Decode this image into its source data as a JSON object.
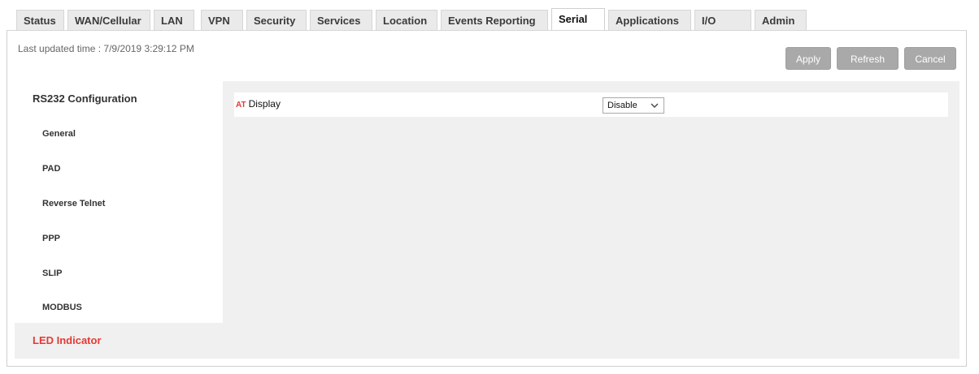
{
  "tabs": [
    {
      "label": "Status"
    },
    {
      "label": "WAN/Cellular"
    },
    {
      "label": "LAN"
    },
    {
      "label": "VPN"
    },
    {
      "label": "Security"
    },
    {
      "label": "Services"
    },
    {
      "label": "Location"
    },
    {
      "label": "Events Reporting"
    },
    {
      "label": "Serial"
    },
    {
      "label": "Applications"
    },
    {
      "label": "I/O"
    },
    {
      "label": "Admin"
    }
  ],
  "active_tab": "Serial",
  "header": {
    "last_updated": "Last updated time : 7/9/2019 3:29:12 PM"
  },
  "toolbar": {
    "apply_label": "Apply",
    "refresh_label": "Refresh",
    "cancel_label": "Cancel"
  },
  "sidebar": {
    "section_title": "RS232 Configuration",
    "items": [
      {
        "label": "General"
      },
      {
        "label": "PAD"
      },
      {
        "label": "Reverse Telnet"
      },
      {
        "label": "PPP"
      },
      {
        "label": "SLIP"
      },
      {
        "label": "MODBUS"
      }
    ],
    "led_label": "LED Indicator"
  },
  "content": {
    "at_icon_text": "AT",
    "display_label": "Display",
    "display_value": "Disable",
    "dropdown_icon": "chevron-down-icon"
  },
  "colors": {
    "accent_red": "#e53935",
    "button_gray": "#a9a9a9",
    "panel_gray": "#f0f0f0"
  }
}
